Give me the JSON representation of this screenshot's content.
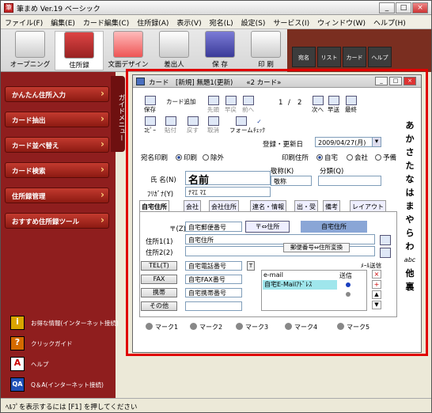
{
  "app": {
    "title": "筆まめ Ver.19 ベーシック",
    "icon": "筆"
  },
  "window_buttons": {
    "minimize": "_",
    "maximize": "□",
    "close": "×"
  },
  "menu": [
    "ファイル(F)",
    "編集(E)",
    "カード編集(C)",
    "住所録(A)",
    "表示(V)",
    "宛名(L)",
    "設定(S)",
    "サービス(I)",
    "ウィンドウ(W)",
    "ヘルプ(H)"
  ],
  "main_tools": [
    "オープニング",
    "住所録",
    "文面デザイン",
    "差出人",
    "保 存",
    "印 刷"
  ],
  "right_tools": [
    "宛名",
    "リスト",
    "カード",
    "ヘルプ"
  ],
  "guide": {
    "tab": "ガイドメニュー",
    "buttons": [
      "かんたん住所入力",
      "カード抽出",
      "カード並べ替え",
      "カード検索",
      "住所録管理",
      "おすすめ住所録ツール"
    ],
    "items": [
      {
        "label": "お得な情報(インターネット接続)",
        "icon": "info-icon",
        "icon_text": "i"
      },
      {
        "label": "クリックガイド",
        "icon": "question-icon",
        "icon_text": "?"
      },
      {
        "label": "ヘルプ",
        "icon": "help-icon",
        "icon_text": "A"
      },
      {
        "label": "Q＆A(インターネット接続)",
        "icon": "qa-icon",
        "icon_text": "QA"
      }
    ]
  },
  "status": "ﾍﾙﾌﾟを表示するには [F1] を押してください",
  "card": {
    "title": "カード　[新規]  無題1(更新)　　«2 カード»",
    "toolbar": [
      "保存",
      "カード追加",
      "先頭",
      "早戻",
      "前へ",
      "次へ",
      "早送",
      "最終"
    ],
    "page_current": "1",
    "page_sep": "/",
    "page_total": "2",
    "toolbar2": [
      "ｺﾋﾟｰ",
      "貼付",
      "戻す",
      "取消",
      "フォーム",
      "ﾁｪｯｸ"
    ],
    "reg_date_label": "登録・更新日",
    "reg_date": "2009/04/27(月)",
    "atena_label": "宛名印刷",
    "atena_options": [
      "印刷",
      "除外"
    ],
    "print_addr_label": "印刷住所",
    "print_addr_options": [
      "自宅",
      "会社",
      "予備"
    ],
    "name_label": "氏 名(N)",
    "name_value": "名前",
    "kana_label": "ﾌﾘｶﾞﾅ(Y)",
    "kana_value": "ﾅﾏｴ ﾏｴ",
    "title_label": "敬称(K)",
    "title_value": "敬称",
    "class_label": "分類(Q)",
    "tabs": [
      "自宅住所",
      "会社",
      "会社住所",
      "連名・情報",
      "出・受",
      "備考",
      "レイアウト"
    ],
    "postal_label": "〒(Z)",
    "postal_value": "自宅郵便番号",
    "conv_button": "〒⇔住所",
    "home_addr_badge": "自宅住所",
    "addr1_label": "住所1(1)",
    "addr1_value": "自宅住所",
    "addr2_label": "住所2(2)",
    "tooltip": "郵便番号⇔住所変換",
    "email_send_label": "ﾒｰﾙ送信",
    "phone_buttons": [
      "TEL(T)",
      "FAX",
      "携帯",
      "その他"
    ],
    "phone_values": [
      "自宅電話番号",
      "自宅FAX番号",
      "自宅携帯番号",
      ""
    ],
    "email_header": [
      "e-mail",
      "送信"
    ],
    "email_value": "自宅E-Mailｱﾄﾞﾚｽ",
    "marks": [
      "マーク1",
      "マーク2",
      "マーク3",
      "マーク4",
      "マーク5"
    ],
    "kana_index": [
      "あ",
      "か",
      "さ",
      "た",
      "な",
      "は",
      "ま",
      "や",
      "ら",
      "わ",
      "abc",
      "他",
      "裏"
    ]
  }
}
